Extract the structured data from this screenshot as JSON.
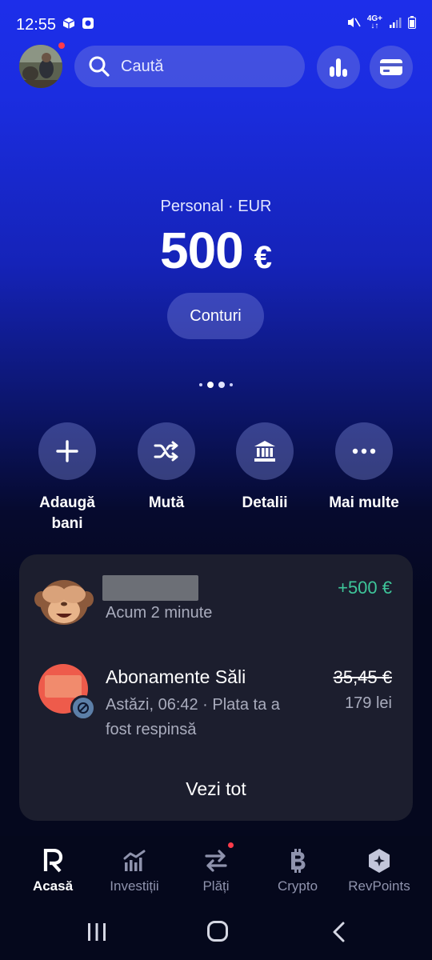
{
  "status_bar": {
    "time": "12:55",
    "network": "4G+"
  },
  "header": {
    "search_placeholder": "Caută",
    "icons": [
      "search-icon",
      "stats-icon",
      "card-icon"
    ]
  },
  "balance": {
    "account_label": "Personal · EUR",
    "amount": "500",
    "currency_symbol": "€",
    "accounts_button": "Conturi"
  },
  "actions": [
    {
      "label": "Adaugă bani",
      "icon": "plus-icon"
    },
    {
      "label": "Mută",
      "icon": "shuffle-icon"
    },
    {
      "label": "Detalii",
      "icon": "bank-icon"
    },
    {
      "label": "Mai multe",
      "icon": "more-icon"
    }
  ],
  "transactions": [
    {
      "subtitle": "Acum 2 minute",
      "amount": "+500 €",
      "amount_color": "#3ec69a"
    },
    {
      "title": "Abonamente Săli",
      "subtitle": "Astăzi, 06:42 · Plata ta a fost respinsă",
      "amount": "35,45 €",
      "amount_secondary": "179 lei"
    }
  ],
  "see_all": "Vezi tot",
  "bottom_nav": [
    {
      "label": "Acasă",
      "icon": "revolut-r-icon",
      "active": true
    },
    {
      "label": "Investiții",
      "icon": "invest-chart-icon",
      "active": false
    },
    {
      "label": "Plăți",
      "icon": "transfer-arrows-icon",
      "active": false
    },
    {
      "label": "Crypto",
      "icon": "bitcoin-icon",
      "active": false
    },
    {
      "label": "RevPoints",
      "icon": "revpoints-icon",
      "active": false
    }
  ],
  "colors": {
    "accent_blue": "#1d2eea",
    "positive": "#3ec69a",
    "notification": "#ff3b4a",
    "card_bg": "#1c1e2e"
  }
}
